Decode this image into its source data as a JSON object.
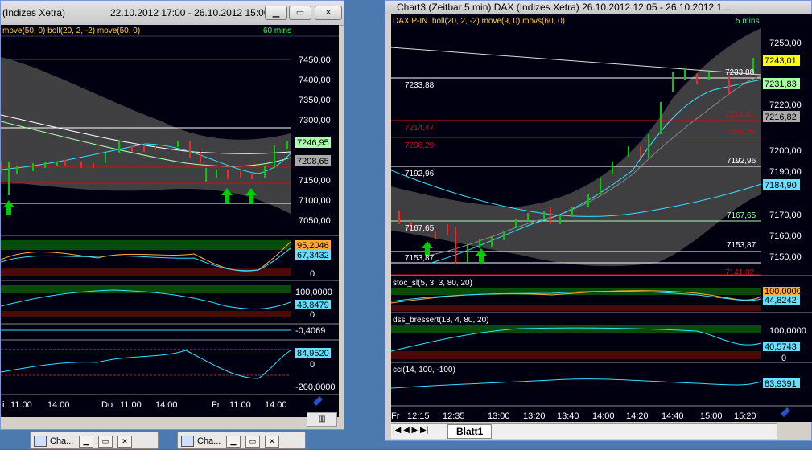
{
  "left_window": {
    "title": "(Indizes Xetra)",
    "date_range": "22.10.2012 17:00 - 26.10.2012 15:00",
    "indicator_label": "move(50, 0) boll(20, 2, -2) move(50, 0)",
    "timeframe": "60 mins",
    "price_ticks": [
      "7450,00",
      "7400,00",
      "7350,00",
      "7300,00",
      "7250,00",
      "7200,00",
      "7150,00",
      "7100,00",
      "7050,00"
    ],
    "price_tags": {
      "last": "7246,95",
      "mid": "7208,65"
    },
    "osc1_tags": [
      "95,2046",
      "67,3432",
      "0"
    ],
    "osc2_tags": [
      "100,0000",
      "43,8479",
      "0"
    ],
    "osc3_tag": "-0,4069",
    "osc4_tags": [
      "84,9520",
      "0",
      "-200,0000"
    ],
    "time_axis": [
      "i",
      "11:00",
      "14:00",
      "Do",
      "11:00",
      "14:00",
      "Fr",
      "11:00",
      "14:00"
    ]
  },
  "right_window": {
    "title": "Chart3 (Zeitbar 5 min)  DAX (Indizes Xetra) 26.10.2012 12:05 - 26.10.2012 1...",
    "indicator_label": "DAX P-IN. boll(20, 2, -2) move(9, 0) movs(60, 0)",
    "timeframe": "5 mins",
    "price_ticks": [
      "7250,00",
      "7240,00",
      "7230,00",
      "7220,00",
      "7210,00",
      "7200,00",
      "7190,00",
      "7180,00",
      "7170,00",
      "7160,00",
      "7150,00"
    ],
    "price_tags": {
      "last": "7243,01",
      "a": "7231,83",
      "b": "7216,82",
      "c": "7184,90"
    },
    "levels": {
      "l7233": "7233,88",
      "l7214": "7214,47",
      "l7206": "7206,29",
      "l7192": "7192,96",
      "l7167": "7167,65",
      "l7153": "7153,87",
      "l7141": "7141,02"
    },
    "stoc_label": "stoc_sl(5, 3, 3, 80, 20)",
    "stoc_tags": [
      "100,0000",
      "44,8242"
    ],
    "dss_label": "dss_bressert(13, 4, 80, 20)",
    "dss_tags": [
      "100,0000",
      "40,5743",
      "0"
    ],
    "cci_label": "cci(14, 100, -100)",
    "cci_tag": "83,9391",
    "time_axis": [
      "Fr",
      "12:15",
      "12:35",
      "13:00",
      "13:20",
      "13:40",
      "14:00",
      "14:20",
      "14:40",
      "15:00",
      "15:20"
    ],
    "sheet_tab": "Blatt1"
  },
  "taskbar": {
    "items": [
      "Cha...",
      "Cha..."
    ]
  },
  "colors": {
    "bg": "#000011",
    "up": "#00cc00",
    "down": "#ff2222",
    "cyan": "#33e0ff",
    "red_level": "#cc1111",
    "white_level": "#ffffff"
  }
}
